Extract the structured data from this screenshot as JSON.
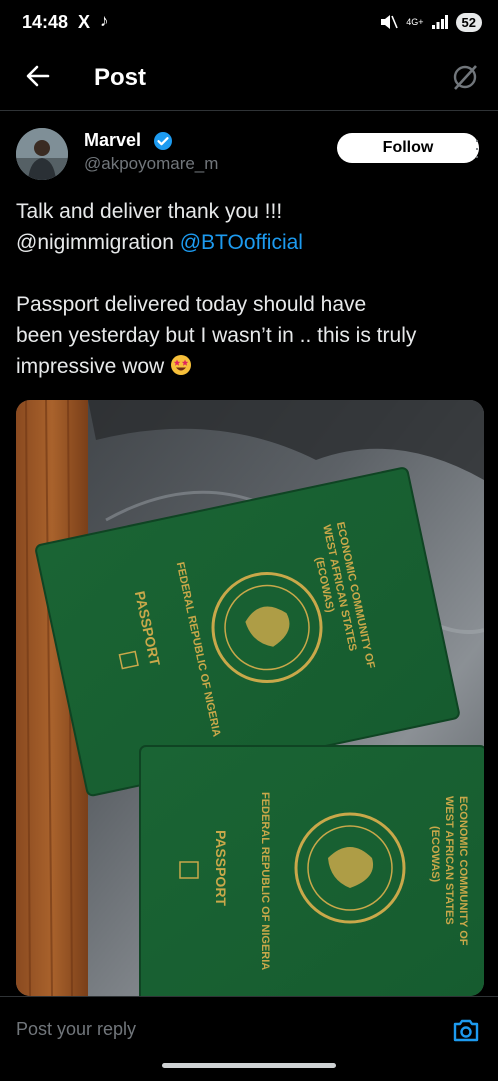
{
  "status_bar": {
    "time": "14:48",
    "x_icon": "X",
    "tiktok_icon": "tiktok-icon",
    "network": "4G+",
    "battery": "52"
  },
  "header": {
    "title": "Post",
    "back_icon": "arrow-left-icon",
    "grok_icon": "grok-icon"
  },
  "post": {
    "author_name": "Marvel",
    "author_handle": "@akpoyomare_m",
    "follow_label": "Follow",
    "line1": "Talk and deliver thank you !!!",
    "mention1": "@nigimmigration",
    "mention2": "@BTOofficial",
    "line3": "Passport delivered today should have",
    "line4": "been yesterday but I wasn’t in .. this is truly",
    "line5": "impressive wow",
    "emoji": "star-struck-emoji"
  },
  "photo": {
    "passport1": {
      "l1": "ECONOMIC COMMUNITY OF",
      "l2": "WEST AFRICAN STATES",
      "l3": "(ECOWAS)",
      "l4": "FEDERAL REPUBLIC OF NIGERIA",
      "l5": "PASSPORT"
    },
    "passport2": {
      "l1": "ECONOMIC COMMUNITY OF",
      "l2": "WEST AFRICAN STATES",
      "l3": "(ECOWAS)",
      "l4": "FEDERAL REPUBLIC OF NIGERIA",
      "l5": "PASSPORT"
    }
  },
  "reply": {
    "placeholder": "Post your reply",
    "camera_icon": "camera-icon"
  },
  "colors": {
    "link": "#1d9bf0",
    "passport_green": "#1f6e3a",
    "gold": "#c9a84a"
  }
}
